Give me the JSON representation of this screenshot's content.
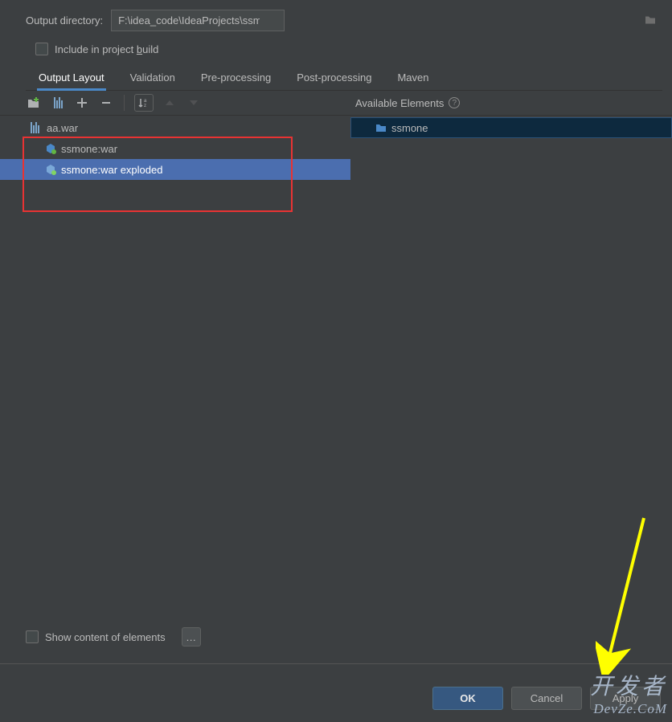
{
  "outputDirectory": {
    "label": "Output directory:",
    "value": "F:\\idea_code\\IdeaProjects\\ssmone\\out\\artifacts\\aa"
  },
  "includeInProjectBuild": {
    "prefix": "Include in project ",
    "underlined": "b",
    "suffix": "uild"
  },
  "tabs": {
    "items": [
      {
        "label": "Output Layout",
        "active": true
      },
      {
        "label": "Validation",
        "active": false
      },
      {
        "label": "Pre-processing",
        "active": false
      },
      {
        "label": "Post-processing",
        "active": false
      },
      {
        "label": "Maven",
        "active": false
      }
    ]
  },
  "availableElements": {
    "header": "Available Elements",
    "items": [
      {
        "label": "ssmone"
      }
    ]
  },
  "tree": {
    "root": {
      "label": "aa.war"
    },
    "children": [
      {
        "label": "ssmone:war",
        "selected": false
      },
      {
        "label": "ssmone:war exploded",
        "selected": true
      }
    ]
  },
  "showContentLabel": "Show content of elements",
  "buttons": {
    "ok": "OK",
    "cancel": "Cancel",
    "apply": "Apply"
  },
  "watermark": {
    "line1": "开发者",
    "line2": "DevZe.CoM"
  }
}
